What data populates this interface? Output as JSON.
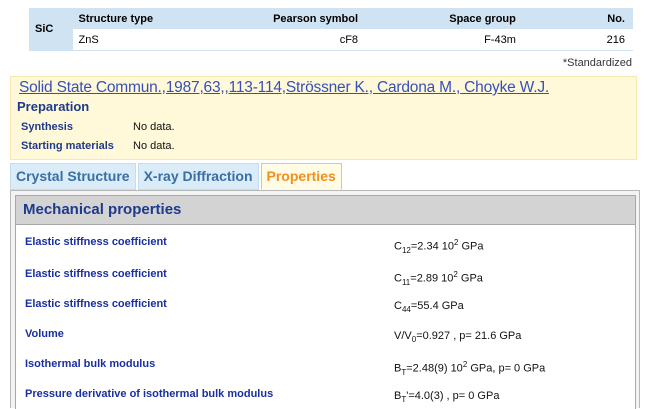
{
  "compound": {
    "formula": "SiC",
    "headers": {
      "structure_type": "Structure type",
      "pearson_symbol": "Pearson symbol",
      "space_group": "Space group",
      "no": "No."
    },
    "values": {
      "structure_type": "ZnS",
      "pearson_symbol": "cF8",
      "space_group": "F-43m",
      "no": "216"
    },
    "note": "*Standardized"
  },
  "reference": {
    "citation": "Solid State Commun.,1987,63,,113-114,Strössner K., Cardona M., Choyke W.J."
  },
  "preparation": {
    "title": "Preparation",
    "synthesis_label": "Synthesis",
    "synthesis_value": "No data.",
    "starting_label": "Starting materials",
    "starting_value": "No data."
  },
  "tabs": [
    {
      "label": "Crystal Structure",
      "active": false
    },
    {
      "label": "X-ray Diffraction",
      "active": false
    },
    {
      "label": "Properties",
      "active": true
    }
  ],
  "properties": {
    "section_title": "Mechanical properties",
    "items": [
      {
        "label": "Elastic stiffness coefficient",
        "sym": "C",
        "sub": "12",
        "mid": "=2.34 10",
        "sup": "2",
        "rest": " GPa"
      },
      {
        "label": "Elastic stiffness coefficient",
        "sym": "C",
        "sub": "11",
        "mid": "=2.89 10",
        "sup": "2",
        "rest": " GPa"
      },
      {
        "label": "Elastic stiffness coefficient",
        "sym": "C",
        "sub": "44",
        "mid": "=55.4 GPa"
      },
      {
        "label": "Volume",
        "sym": "V/V",
        "sub": "0",
        "mid": "=0.927 , p= 21.6 GPa"
      },
      {
        "label": "Isothermal bulk modulus",
        "sym": "B",
        "sub": "T",
        "mid": "=2.48(9) 10",
        "sup": "2",
        "rest": " GPa, p= 0 GPa"
      },
      {
        "label": "Pressure derivative of isothermal bulk modulus",
        "sym": "B",
        "sub": "T",
        "mid": "'=4.0(3) , p= 0 GPa"
      }
    ]
  }
}
